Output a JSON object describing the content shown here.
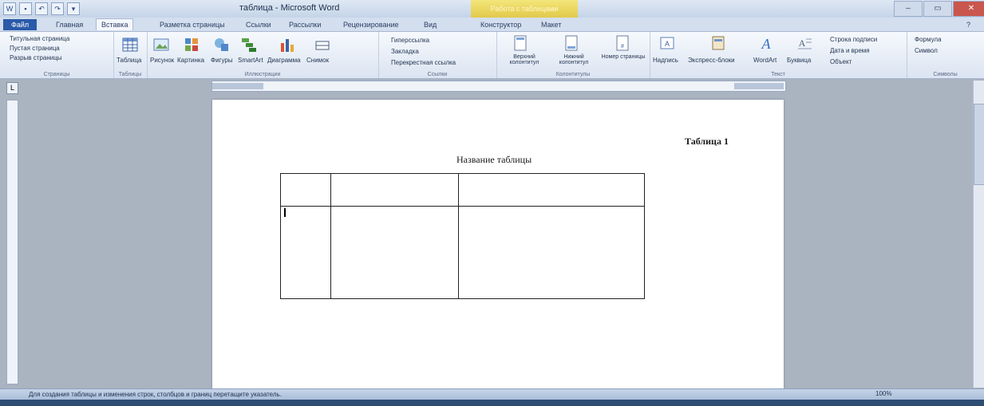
{
  "window": {
    "title": "таблица - Microsoft Word",
    "context_tab": "Работа с таблицами"
  },
  "tabs": [
    "Файл",
    "Главная",
    "Вставка",
    "Разметка страницы",
    "Ссылки",
    "Рассылки",
    "Рецензирование",
    "Вид",
    "Конструктор",
    "Макет"
  ],
  "ribbon": {
    "pages_group": {
      "items": [
        "Титульная страница",
        "Пустая страница",
        "Разрыв страницы"
      ],
      "label": "Страницы"
    },
    "tables_group": {
      "button": "Таблица",
      "label": "Таблицы"
    },
    "illustrations_group": {
      "buttons": [
        "Рисунок",
        "Картинка",
        "Фигуры",
        "SmartArt",
        "Диаграмма",
        "Снимок"
      ],
      "label": "Иллюстрации"
    },
    "links_group": {
      "items": [
        "Гиперссылка",
        "Закладка",
        "Перекрестная ссылка"
      ],
      "label": "Ссылки"
    },
    "header_footer_group": {
      "buttons": [
        "Верхний колонтитул",
        "Нижний колонтитул",
        "Номер страницы"
      ],
      "label": "Колонтитулы"
    },
    "text_group": {
      "buttons": [
        "Надпись",
        "Экспресс-блоки",
        "WordArt",
        "Буквица"
      ],
      "items": [
        "Строка подписи",
        "Дата и время",
        "Объект"
      ],
      "label": "Текст"
    },
    "symbols_group": {
      "items": [
        "Формула",
        "Символ"
      ],
      "label": "Символы"
    }
  },
  "document": {
    "table_number": "Таблица 1",
    "table_title": "Название таблицы"
  },
  "status": {
    "hint": "Для создания таблицы и изменения строк, столбцов и границ перетащите указатель.",
    "zoom": "100%"
  }
}
